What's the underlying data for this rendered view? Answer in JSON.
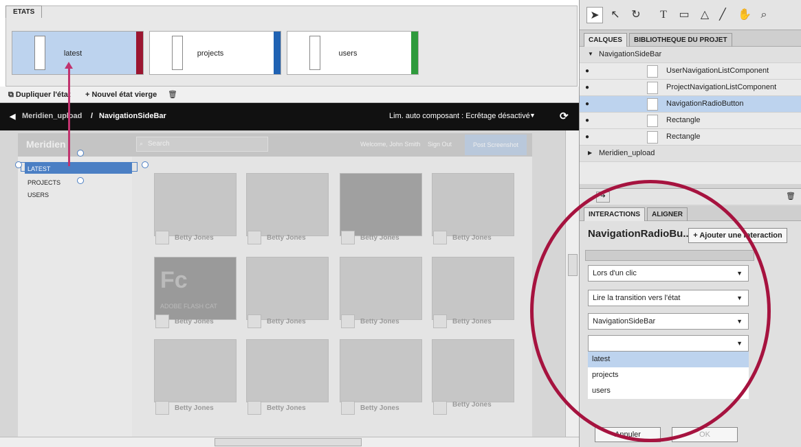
{
  "states_panel": {
    "tab": "ETATS",
    "states": [
      {
        "label": "latest",
        "color": "#9b1530"
      },
      {
        "label": "projects",
        "color": "#1f62b3"
      },
      {
        "label": "users",
        "color": "#2e9a3c"
      }
    ]
  },
  "toolbar": {
    "duplicate": "Dupliquer l'état",
    "new_blank": "+ Nouvel état vierge"
  },
  "breadcrumb": {
    "root": "Meridien_upload",
    "separator": "/",
    "current": "NavigationSideBar",
    "clip": "Lim. auto composant : Ecrêtage désactivé"
  },
  "app_preview": {
    "brand": "Meridien",
    "search_placeholder": "Search",
    "welcome": "Welcome, John Smith",
    "sign_out": "Sign Out",
    "post_button": "Post Screenshot",
    "nav": [
      "LATEST",
      "PROJECTS",
      "USERS"
    ],
    "card_caption": "Betty Jones",
    "fc_text": "Fc",
    "fc_sub": "ADOBE FLASH CAT"
  },
  "tools": [
    "selection-icon",
    "direct-select-icon",
    "rotate-icon",
    "text-icon",
    "rectangle-icon",
    "triangle-icon",
    "line-icon",
    "hand-icon",
    "zoom-icon"
  ],
  "layers_panel": {
    "tabs": [
      "CALQUES",
      "BIBLIOTHEQUE DU PROJET"
    ],
    "group": "NavigationSideBar",
    "items": [
      "UserNavigationListComponent",
      "ProjectNavigationListComponent",
      "NavigationRadioButton",
      "Rectangle",
      "Rectangle"
    ],
    "sibling_group": "Meridien_upload"
  },
  "interactions_panel": {
    "tabs": [
      "INTERACTIONS",
      "ALIGNER"
    ],
    "component": "NavigationRadioBu...",
    "add_button": "+ Ajouter une interaction",
    "trigger": "Lors d'un clic",
    "action": "Lire la transition vers l'état",
    "target": "NavigationSideBar",
    "state_select": "",
    "options": [
      "latest",
      "projects",
      "users"
    ],
    "cancel": "Annuler",
    "ok": "OK"
  },
  "colors": {
    "highlight": "#a6133f",
    "selection": "#4b7fc4"
  }
}
